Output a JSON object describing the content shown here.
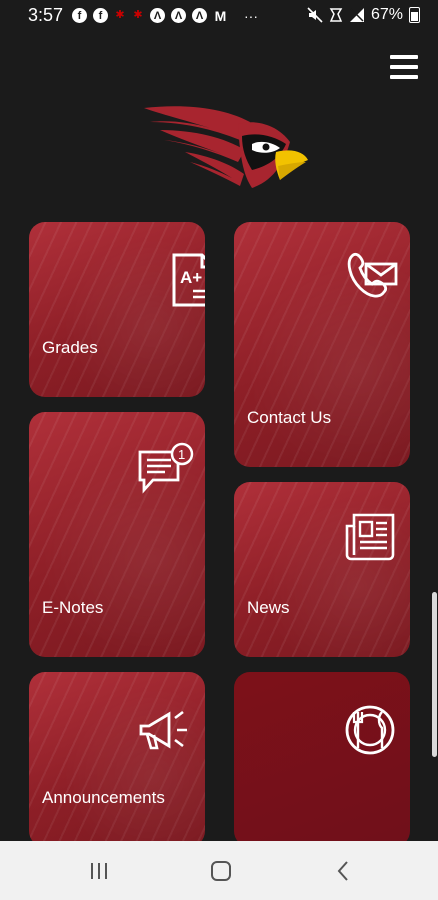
{
  "status_bar": {
    "time": "3:57",
    "battery": "67%",
    "overflow": "···"
  },
  "icons": {
    "menu": "hamburger-menu-icon",
    "logo": "cardinal-logo"
  },
  "tiles": [
    {
      "label": "Grades",
      "icon": "grades-document-icon"
    },
    {
      "label": "Contact Us",
      "icon": "contact-phone-mail-icon"
    },
    {
      "label": "E-Notes",
      "icon": "notification-message-icon",
      "badge": "1"
    },
    {
      "label": "News",
      "icon": "newspaper-icon"
    },
    {
      "label": "Announcements",
      "icon": "megaphone-icon"
    },
    {
      "label": "",
      "icon": "dining-plate-icon"
    }
  ],
  "grades_icon_text": "A+",
  "colors": {
    "tile": "#9e2630",
    "tile_dark": "#76121b",
    "background": "#1b1b1b",
    "beak": "#f2c200"
  }
}
